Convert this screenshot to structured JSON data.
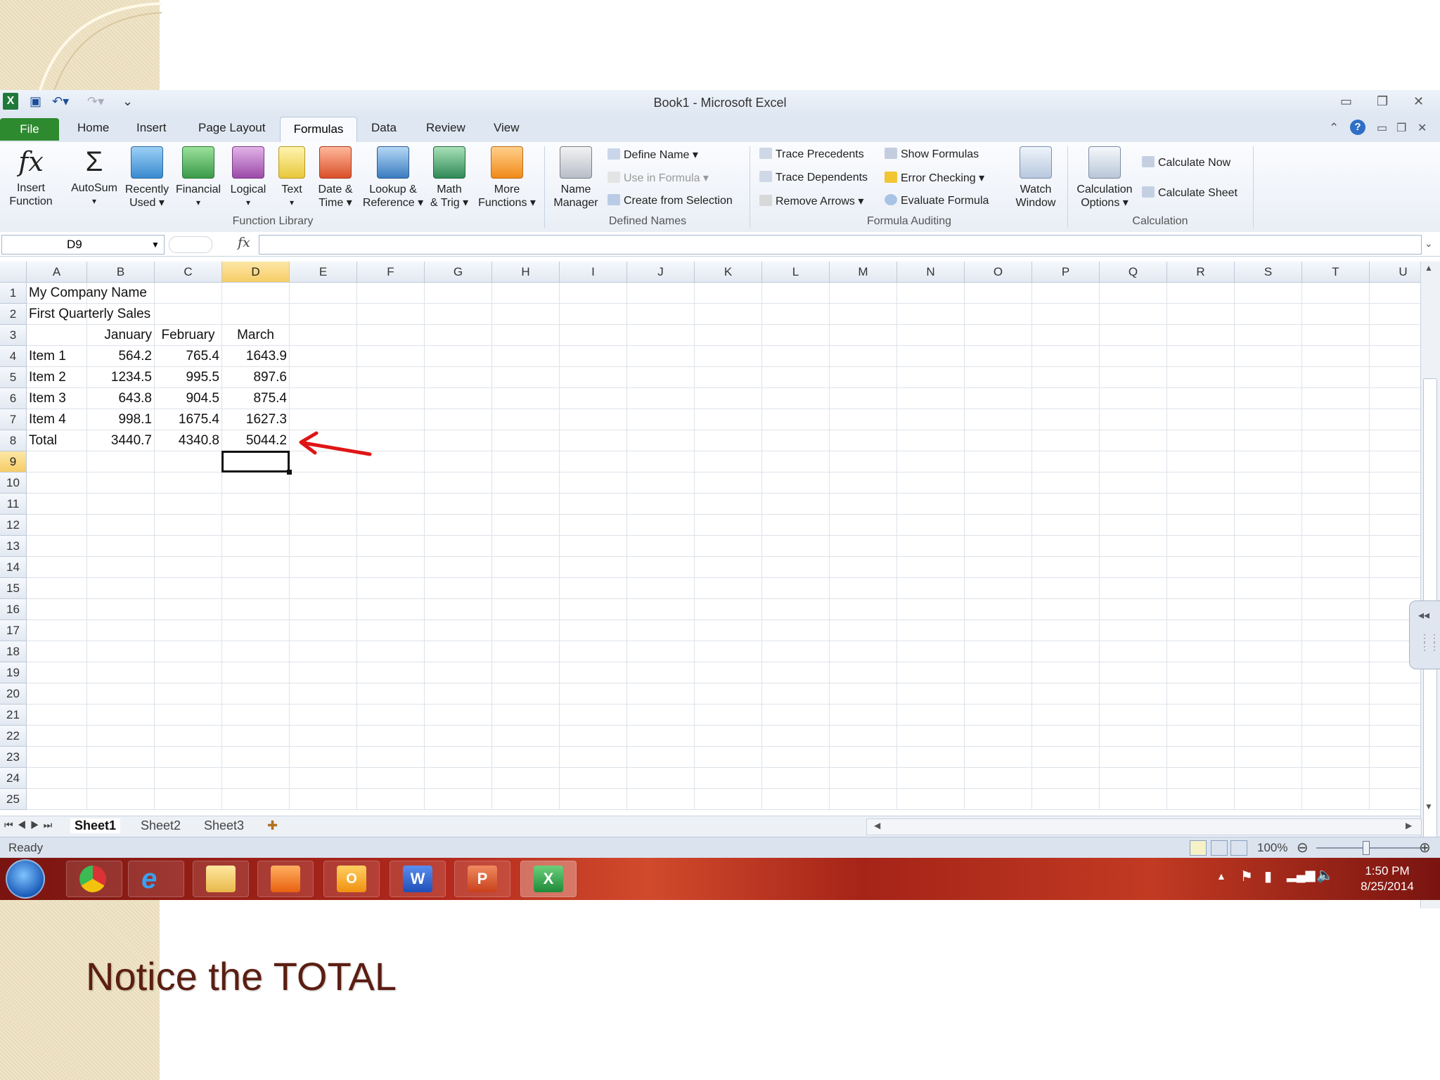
{
  "caption": "Notice the TOTAL",
  "window": {
    "title": "Book1  -  Microsoft Excel"
  },
  "tabs": [
    "File",
    "Home",
    "Insert",
    "Page Layout",
    "Formulas",
    "Data",
    "Review",
    "View"
  ],
  "ribbon": {
    "function_library": {
      "label": "Function Library",
      "buttons": [
        {
          "line1": "Insert",
          "line2": "Function",
          "icon": "function-icon"
        },
        {
          "line1": "AutoSum",
          "line2": "▾",
          "icon": "sigma-icon"
        },
        {
          "line1": "Recently",
          "line2": "Used ▾",
          "icon": "book-icon"
        },
        {
          "line1": "Financial",
          "line2": "▾",
          "icon": "book-icon"
        },
        {
          "line1": "Logical",
          "line2": "▾",
          "icon": "book-icon"
        },
        {
          "line1": "Text",
          "line2": "▾",
          "icon": "book-icon"
        },
        {
          "line1": "Date &",
          "line2": "Time ▾",
          "icon": "book-icon"
        },
        {
          "line1": "Lookup &",
          "line2": "Reference ▾",
          "icon": "book-icon"
        },
        {
          "line1": "Math",
          "line2": "& Trig ▾",
          "icon": "book-icon"
        },
        {
          "line1": "More",
          "line2": "Functions ▾",
          "icon": "book-icon"
        }
      ]
    },
    "defined_names": {
      "label": "Defined Names",
      "manager": {
        "line1": "Name",
        "line2": "Manager"
      },
      "define_name": "Define Name ▾",
      "use_in_formula": "Use in Formula ▾",
      "create_from_selection": "Create from Selection"
    },
    "formula_auditing": {
      "label": "Formula Auditing",
      "trace_precedents": "Trace Precedents",
      "trace_dependents": "Trace Dependents",
      "remove_arrows": "Remove Arrows ▾",
      "show_formulas": "Show Formulas",
      "error_checking": "Error Checking ▾",
      "evaluate_formula": "Evaluate Formula",
      "watch": {
        "line1": "Watch",
        "line2": "Window"
      }
    },
    "calculation": {
      "label": "Calculation",
      "options": {
        "line1": "Calculation",
        "line2": "Options ▾"
      },
      "calc_now": "Calculate Now",
      "calc_sheet": "Calculate Sheet"
    }
  },
  "formula_bar": {
    "name_box": "D9",
    "fx": "fx",
    "formula": ""
  },
  "columns": [
    "A",
    "B",
    "C",
    "D",
    "E",
    "F",
    "G",
    "H",
    "I",
    "J",
    "K",
    "L",
    "M",
    "N",
    "O",
    "P",
    "Q",
    "R",
    "S",
    "T",
    "U"
  ],
  "rows": [
    "1",
    "2",
    "3",
    "4",
    "5",
    "6",
    "7",
    "8",
    "9",
    "10",
    "11",
    "12",
    "13",
    "14",
    "15",
    "16",
    "17",
    "18",
    "19",
    "20",
    "21",
    "22",
    "23",
    "24",
    "25"
  ],
  "cells": {
    "A1": "My Company Name",
    "A2": "First Quarterly Sales",
    "B3": "January",
    "C3": "February",
    "D3": "March",
    "A4": "Item 1",
    "B4": "564.2",
    "C4": "765.4",
    "D4": "1643.9",
    "A5": "Item 2",
    "B5": "1234.5",
    "C5": "995.5",
    "D5": "897.6",
    "A6": "Item 3",
    "B6": "643.8",
    "C6": "904.5",
    "D6": "875.4",
    "A7": "Item 4",
    "B7": "998.1",
    "C7": "1675.4",
    "D7": "1627.3",
    "A8": "Total",
    "B8": "3440.7",
    "C8": "4340.8",
    "D8": "5044.2"
  },
  "selected_cell": "D9",
  "sheets": [
    "Sheet1",
    "Sheet2",
    "Sheet3"
  ],
  "status": {
    "text": "Ready",
    "zoom": "100%"
  },
  "clock": {
    "time": "1:50 PM",
    "date": "8/25/2014"
  },
  "colors": {
    "file_tab": "#2e8a2e",
    "selected_header": "#f6cd66",
    "arrow": "#e01515",
    "caption": "#5b1e12"
  }
}
